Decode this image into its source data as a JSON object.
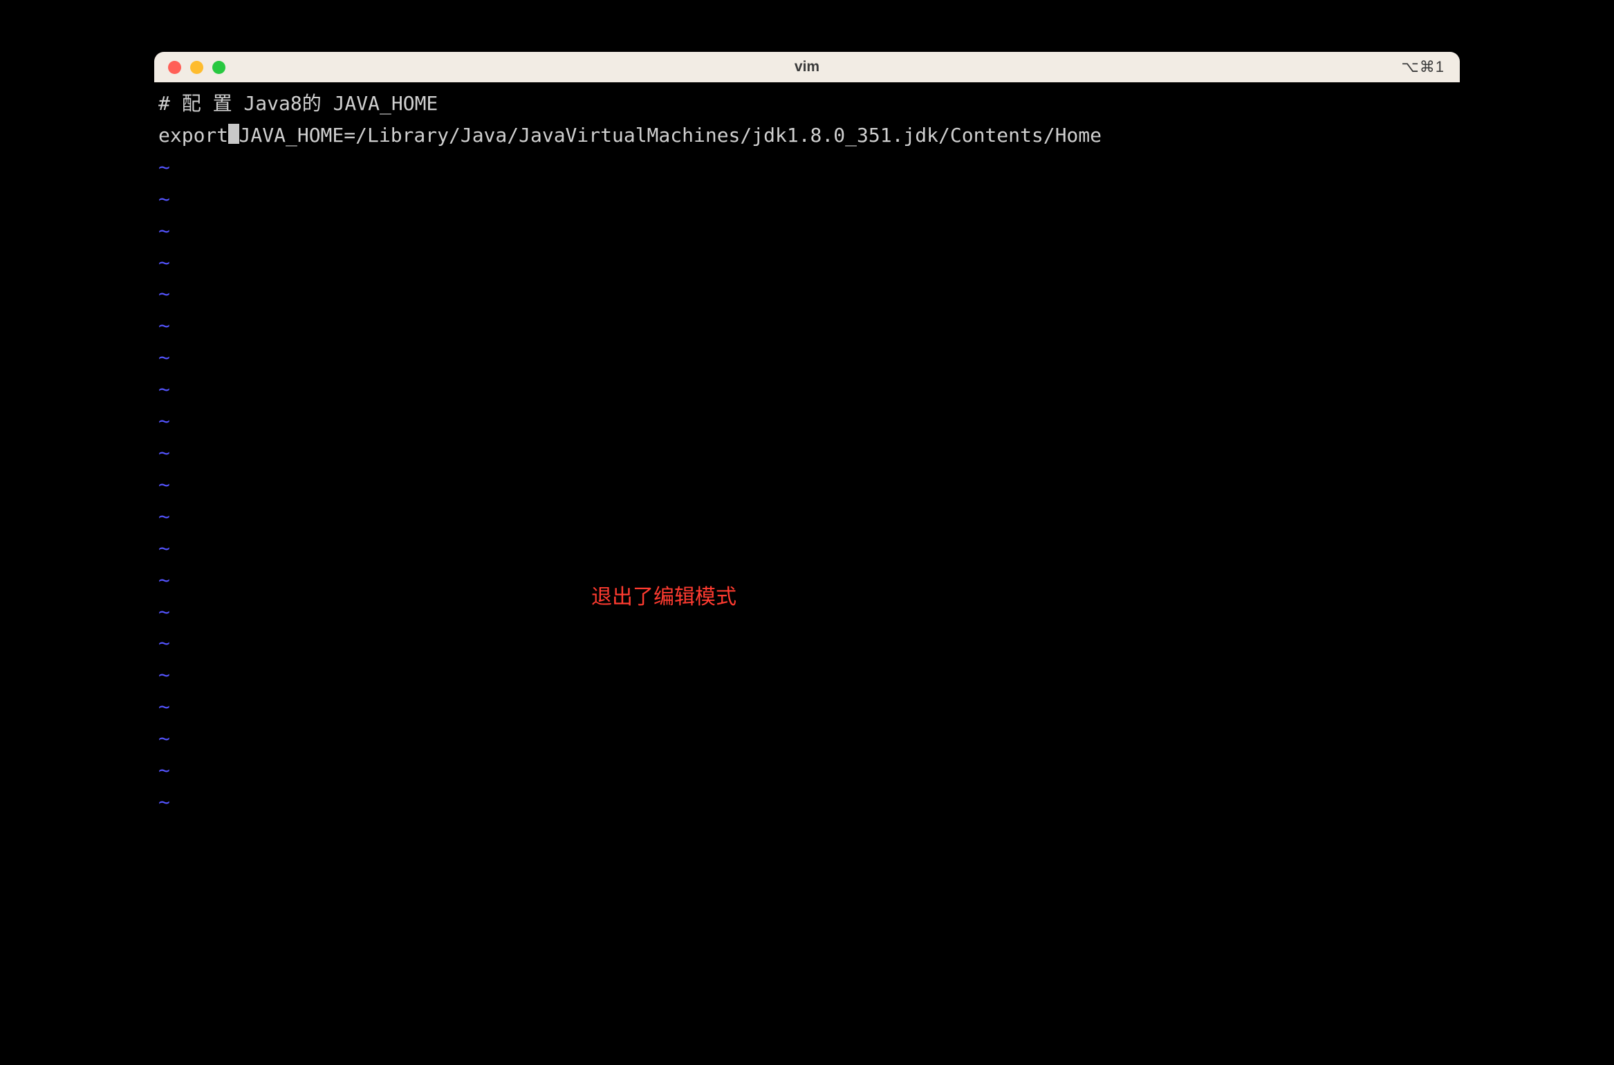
{
  "window": {
    "title": "vim",
    "shortcut": "⌥⌘1"
  },
  "editor": {
    "line1": "# 配 置 Java8的 JAVA_HOME",
    "line2_before_cursor": "export",
    "line2_after_cursor": "JAVA_HOME=/Library/Java/JavaVirtualMachines/jdk1.8.0_351.jdk/Contents/Home",
    "tilde": "~",
    "empty_line_count": 21
  },
  "annotation": {
    "text": "退出了编辑模式"
  }
}
